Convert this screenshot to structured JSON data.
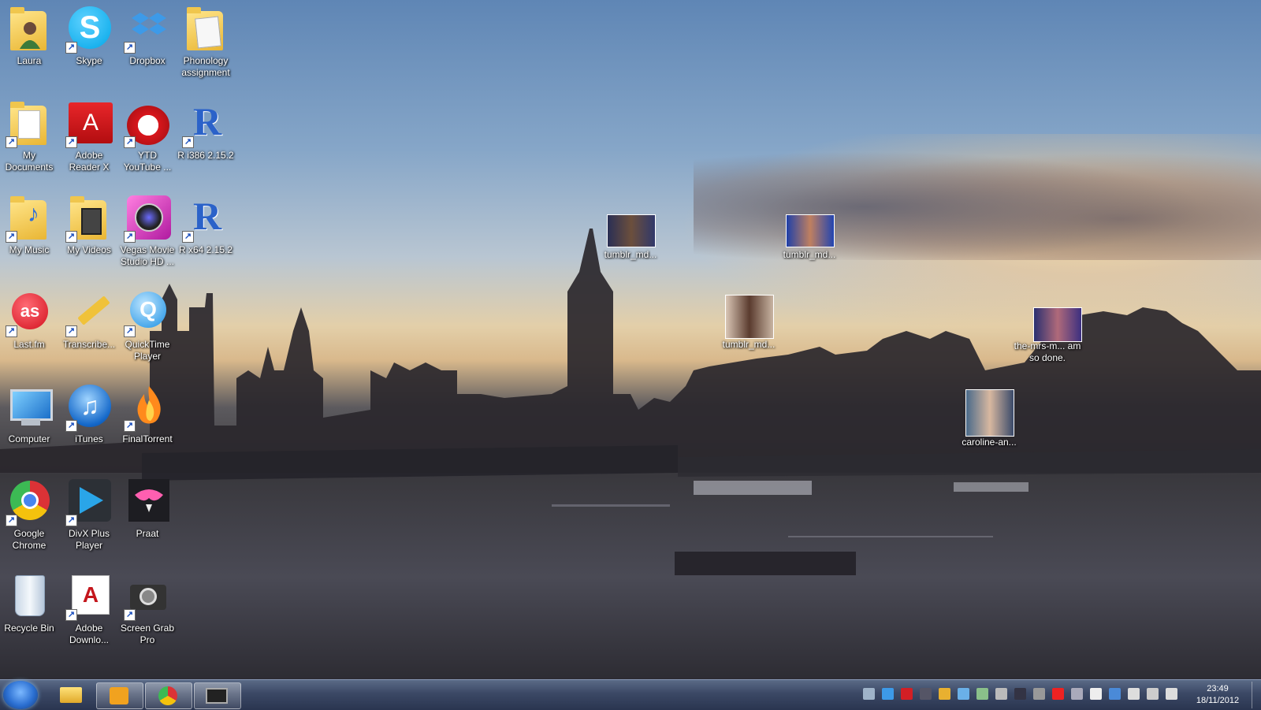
{
  "desktop": {
    "icons": [
      {
        "label": "Laura",
        "icon": "user-folder-icon"
      },
      {
        "label": "Skype",
        "icon": "skype-icon"
      },
      {
        "label": "Dropbox",
        "icon": "dropbox-icon"
      },
      {
        "label": "Phonology assignment",
        "icon": "folder-icon"
      },
      {
        "label": "My Documents",
        "icon": "documents-folder-icon"
      },
      {
        "label": "Adobe Reader X",
        "icon": "adobe-reader-icon"
      },
      {
        "label": "YTD YouTube ...",
        "icon": "ytd-icon"
      },
      {
        "label": "R i386 2.15.2",
        "icon": "r-icon"
      },
      {
        "label": "My Music",
        "icon": "music-folder-icon"
      },
      {
        "label": "My Videos",
        "icon": "videos-folder-icon"
      },
      {
        "label": "Vegas Movie Studio HD ...",
        "icon": "vegas-icon"
      },
      {
        "label": "R x64 2.15.2",
        "icon": "r-icon"
      },
      {
        "label": "Last.fm",
        "icon": "lastfm-icon"
      },
      {
        "label": "Transcribe...",
        "icon": "transcribe-icon"
      },
      {
        "label": "QuickTime Player",
        "icon": "quicktime-icon"
      },
      {
        "label": "Computer",
        "icon": "computer-icon"
      },
      {
        "label": "iTunes",
        "icon": "itunes-icon"
      },
      {
        "label": "FinalTorrent",
        "icon": "finaltorrent-icon"
      },
      {
        "label": "Google Chrome",
        "icon": "chrome-icon"
      },
      {
        "label": "DivX Plus Player",
        "icon": "divx-icon"
      },
      {
        "label": "Praat",
        "icon": "praat-icon"
      },
      {
        "label": "Recycle Bin",
        "icon": "recycle-bin-icon"
      },
      {
        "label": "Adobe Downlo...",
        "icon": "adobe-download-icon"
      },
      {
        "label": "Screen Grab Pro",
        "icon": "camera-icon"
      }
    ],
    "files": [
      {
        "label": "tumblr_md..."
      },
      {
        "label": "tumblr_md..."
      },
      {
        "label": "tumblr_md..."
      },
      {
        "label": "the-mrs-m... am so done."
      },
      {
        "label": "caroline-an..."
      }
    ]
  },
  "taskbar": {
    "pinned": [
      {
        "name": "start-button"
      },
      {
        "name": "explorer-icon"
      },
      {
        "name": "media-player-icon"
      },
      {
        "name": "chrome-icon"
      },
      {
        "name": "screen-capture-icon"
      }
    ],
    "clock": {
      "time": "23:49",
      "date": "18/11/2012"
    }
  },
  "colors": {
    "taskbar": "#2a3550",
    "accent": "#2b6fd1"
  }
}
